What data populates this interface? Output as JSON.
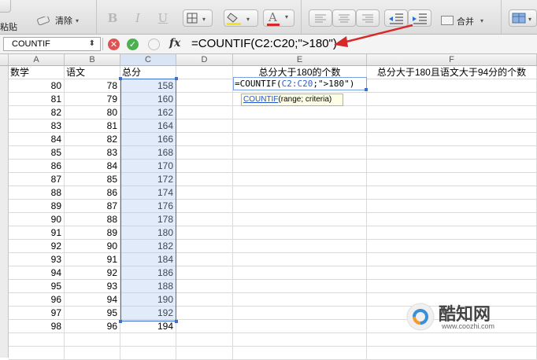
{
  "ribbon": {
    "clear_label": "清除",
    "paste_label": "粘贴",
    "merge_label": "合并",
    "bold": "B",
    "italic": "I",
    "underline": "U",
    "font_color_letter": "A"
  },
  "formula_bar": {
    "name_box": "COUNTIF",
    "fx": "fx",
    "formula": "=COUNTIF(C2:C20;\">180\")"
  },
  "columns": [
    "A",
    "B",
    "C",
    "D",
    "E",
    "F"
  ],
  "headers": {
    "A": "数学",
    "B": "语文",
    "C": "总分",
    "E": "总分大于180的个数",
    "F": "总分大于180且语文大于94分的个数"
  },
  "rows": [
    {
      "math": 80,
      "chinese": 78,
      "total": 158
    },
    {
      "math": 81,
      "chinese": 79,
      "total": 160
    },
    {
      "math": 82,
      "chinese": 80,
      "total": 162
    },
    {
      "math": 83,
      "chinese": 81,
      "total": 164
    },
    {
      "math": 84,
      "chinese": 82,
      "total": 166
    },
    {
      "math": 85,
      "chinese": 83,
      "total": 168
    },
    {
      "math": 86,
      "chinese": 84,
      "total": 170
    },
    {
      "math": 87,
      "chinese": 85,
      "total": 172
    },
    {
      "math": 88,
      "chinese": 86,
      "total": 174
    },
    {
      "math": 89,
      "chinese": 87,
      "total": 176
    },
    {
      "math": 90,
      "chinese": 88,
      "total": 178
    },
    {
      "math": 91,
      "chinese": 89,
      "total": 180
    },
    {
      "math": 92,
      "chinese": 90,
      "total": 182
    },
    {
      "math": 93,
      "chinese": 91,
      "total": 184
    },
    {
      "math": 94,
      "chinese": 92,
      "total": 186
    },
    {
      "math": 95,
      "chinese": 93,
      "total": 188
    },
    {
      "math": 96,
      "chinese": 94,
      "total": 190
    },
    {
      "math": 97,
      "chinese": 95,
      "total": 192
    },
    {
      "math": 98,
      "chinese": 96,
      "total": 194
    }
  ],
  "edit_cell": {
    "prefix": "=COUNTIF(",
    "range": "C2:C20",
    "suffix": ";\">180\")"
  },
  "tooltip": {
    "function_name": "COUNTIF",
    "args": "(range; criteria)"
  },
  "watermark": {
    "brand": "酷知网",
    "url": "www.coozhi.com"
  },
  "colors": {
    "selection_border": "#3b6fd1",
    "annotation_arrow": "#d62a2a",
    "cancel_button": "#e05252",
    "confirm_button": "#4caf50"
  }
}
